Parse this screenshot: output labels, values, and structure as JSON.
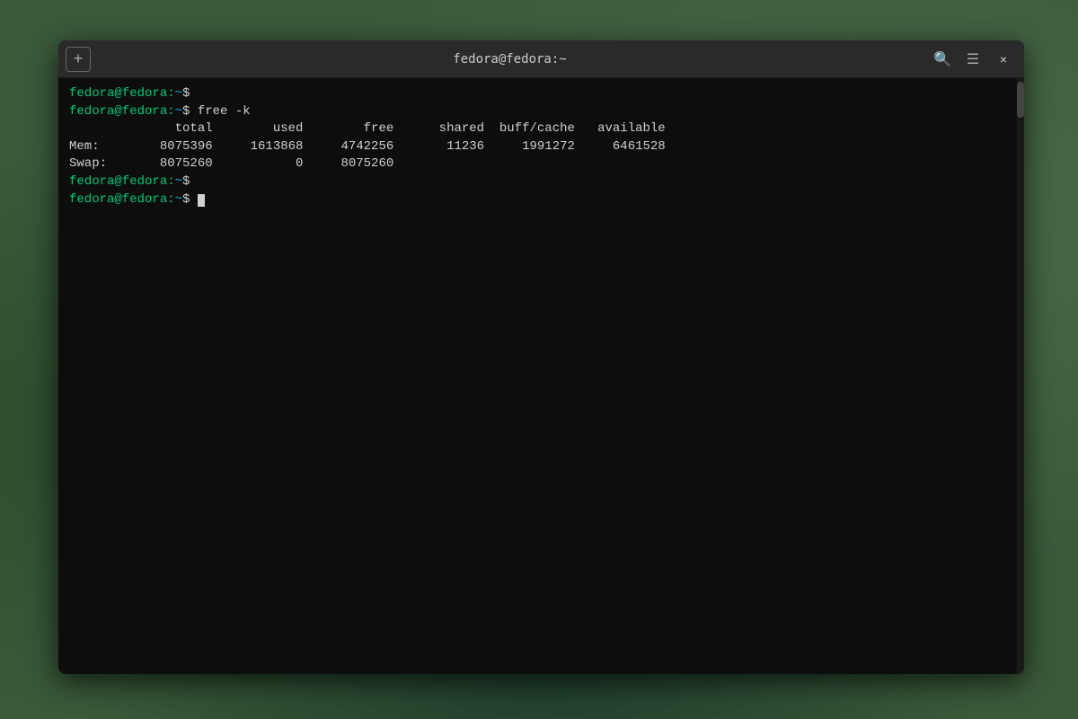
{
  "window": {
    "title": "fedora@fedora:~",
    "new_tab_label": "+",
    "search_icon": "🔍",
    "menu_icon": "☰",
    "close_icon": "×"
  },
  "terminal": {
    "lines": [
      {
        "type": "prompt_cmd",
        "prompt": "fedora@fedora:",
        "tilde": "~",
        "dollar": "$",
        "cmd": ""
      },
      {
        "type": "prompt_cmd",
        "prompt": "fedora@fedora:",
        "tilde": "~",
        "dollar": "$",
        "cmd": " free -k"
      },
      {
        "type": "output",
        "text": "              total        used        free      shared  buff/cache   available"
      },
      {
        "type": "output",
        "text": "Mem:        8075396     1613868     4742256       11236     1991272     6461528"
      },
      {
        "type": "output",
        "text": "Swap:       8075260           0     8075260"
      },
      {
        "type": "prompt_cmd",
        "prompt": "fedora@fedora:",
        "tilde": "~",
        "dollar": "$",
        "cmd": ""
      },
      {
        "type": "prompt_cursor",
        "prompt": "fedora@fedora:",
        "tilde": "~",
        "dollar": "$",
        "cmd": ""
      }
    ]
  }
}
